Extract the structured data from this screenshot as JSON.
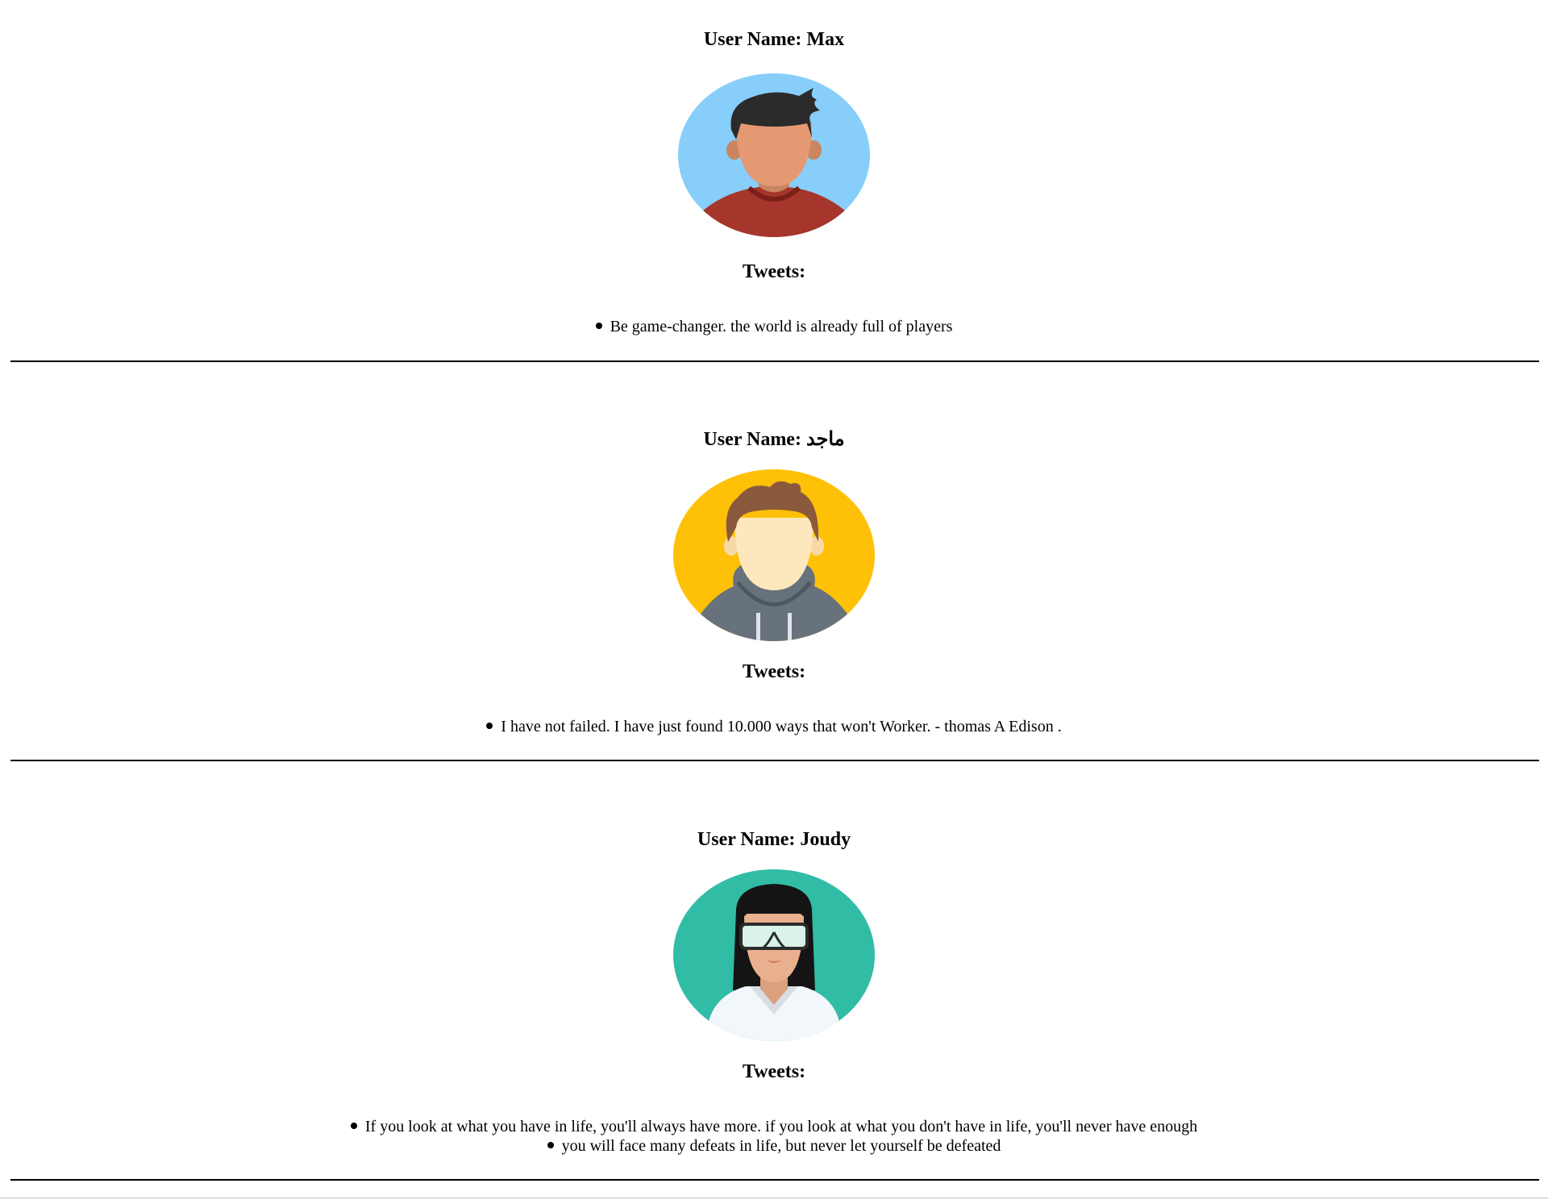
{
  "users": [
    {
      "name_label": "User Name: Max",
      "tweets_heading": "Tweets:",
      "tweets": [
        "Be game-changer. the world is already full of players"
      ],
      "avatar_icon": "male-avatar-red-shirt-icon",
      "avatar_bg": "#87cefa"
    },
    {
      "name_label": "User Name: ماجد",
      "tweets_heading": "Tweets:",
      "tweets": [
        "I have not failed. I have just found 10.000 ways that won't Worker. - thomas A Edison ."
      ],
      "avatar_icon": "male-avatar-hoodie-icon",
      "avatar_bg": "#ffc107"
    },
    {
      "name_label": "User Name: Joudy",
      "tweets_heading": "Tweets:",
      "tweets": [
        "If you look at what you have in life, you'll always have more. if you look at what you don't have in life, you'll never have enough",
        "you will face many defeats in life, but never let yourself be defeated"
      ],
      "avatar_icon": "female-avatar-goggles-icon",
      "avatar_bg": "#31bca6"
    }
  ]
}
